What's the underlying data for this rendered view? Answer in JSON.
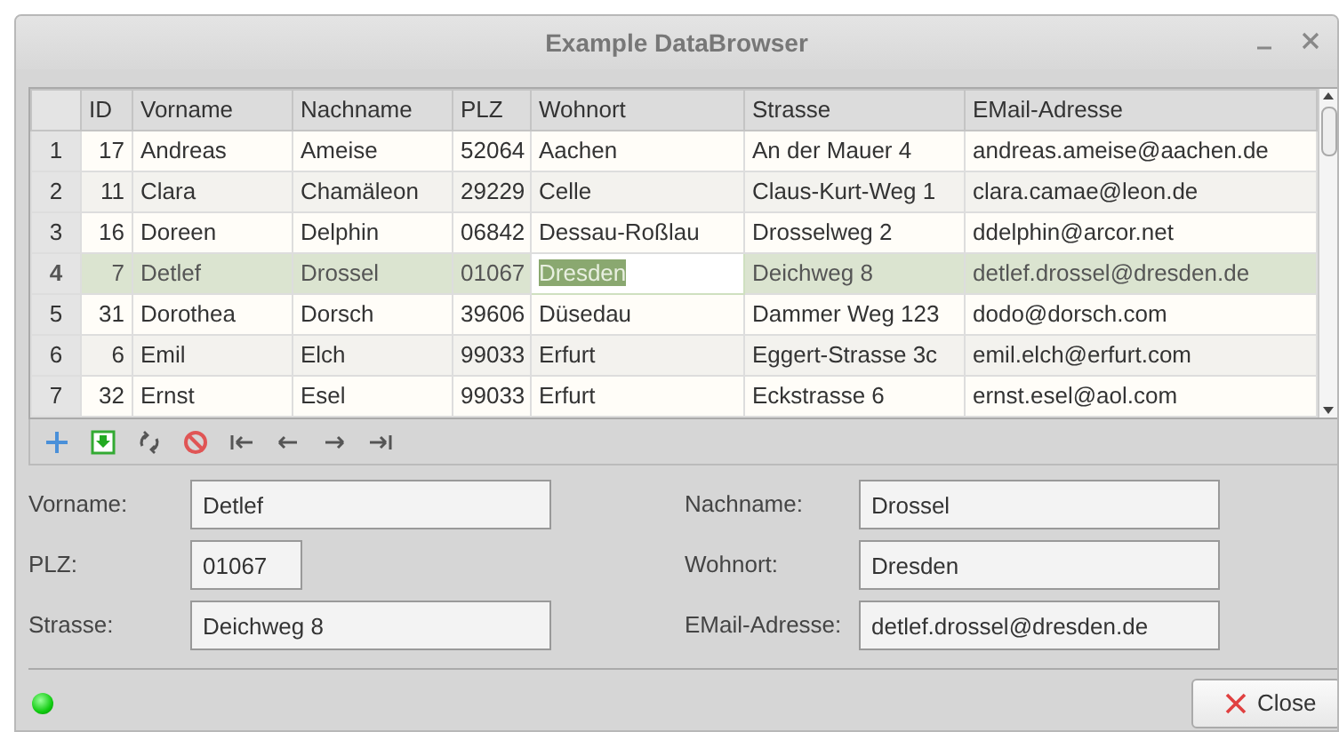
{
  "window": {
    "title": "Example DataBrowser"
  },
  "table": {
    "columns": [
      "ID",
      "Vorname",
      "Nachname",
      "PLZ",
      "Wohnort",
      "Strasse",
      "EMail-Adresse"
    ],
    "rows": [
      {
        "number": "1",
        "selected": false,
        "cells": [
          {
            "text": "17",
            "editing": false
          },
          {
            "text": "Andreas",
            "editing": false
          },
          {
            "text": "Ameise",
            "editing": false
          },
          {
            "text": "52064",
            "editing": false
          },
          {
            "text": "Aachen",
            "editing": false
          },
          {
            "text": "An der Mauer 4",
            "editing": false
          },
          {
            "text": "andreas.ameise@aachen.de",
            "editing": false
          }
        ]
      },
      {
        "number": "2",
        "selected": false,
        "cells": [
          {
            "text": "11",
            "editing": false
          },
          {
            "text": "Clara",
            "editing": false
          },
          {
            "text": "Chamäleon",
            "editing": false
          },
          {
            "text": "29229",
            "editing": false
          },
          {
            "text": "Celle",
            "editing": false
          },
          {
            "text": "Claus-Kurt-Weg 1",
            "editing": false
          },
          {
            "text": "clara.camae@leon.de",
            "editing": false
          }
        ]
      },
      {
        "number": "3",
        "selected": false,
        "cells": [
          {
            "text": "16",
            "editing": false
          },
          {
            "text": "Doreen",
            "editing": false
          },
          {
            "text": "Delphin",
            "editing": false
          },
          {
            "text": "06842",
            "editing": false
          },
          {
            "text": "Dessau-Roßlau",
            "editing": false
          },
          {
            "text": "Drosselweg 2",
            "editing": false
          },
          {
            "text": "ddelphin@arcor.net",
            "editing": false
          }
        ]
      },
      {
        "number": "4",
        "selected": true,
        "cells": [
          {
            "text": "7",
            "editing": false
          },
          {
            "text": "Detlef",
            "editing": false
          },
          {
            "text": "Drossel",
            "editing": false
          },
          {
            "text": "01067",
            "editing": false
          },
          {
            "text": "Dresden",
            "editing": true
          },
          {
            "text": "Deichweg 8",
            "editing": false
          },
          {
            "text": "detlef.drossel@dresden.de",
            "editing": false
          }
        ]
      },
      {
        "number": "5",
        "selected": false,
        "cells": [
          {
            "text": "31",
            "editing": false
          },
          {
            "text": "Dorothea",
            "editing": false
          },
          {
            "text": "Dorsch",
            "editing": false
          },
          {
            "text": "39606",
            "editing": false
          },
          {
            "text": "Düsedau",
            "editing": false
          },
          {
            "text": "Dammer Weg 123",
            "editing": false
          },
          {
            "text": "dodo@dorsch.com",
            "editing": false
          }
        ]
      },
      {
        "number": "6",
        "selected": false,
        "cells": [
          {
            "text": "6",
            "editing": false
          },
          {
            "text": "Emil",
            "editing": false
          },
          {
            "text": "Elch",
            "editing": false
          },
          {
            "text": "99033",
            "editing": false
          },
          {
            "text": "Erfurt",
            "editing": false
          },
          {
            "text": "Eggert-Strasse 3c",
            "editing": false
          },
          {
            "text": "emil.elch@erfurt.com",
            "editing": false
          }
        ]
      },
      {
        "number": "7",
        "selected": false,
        "cells": [
          {
            "text": "32",
            "editing": false
          },
          {
            "text": "Ernst",
            "editing": false
          },
          {
            "text": "Esel",
            "editing": false
          },
          {
            "text": "99033",
            "editing": false
          },
          {
            "text": "Erfurt",
            "editing": false
          },
          {
            "text": "Eckstrasse 6",
            "editing": false
          },
          {
            "text": "ernst.esel@aol.com",
            "editing": false
          }
        ]
      }
    ]
  },
  "form": {
    "left": [
      {
        "label": "Vorname:",
        "value": "Detlef",
        "kind": "wide"
      },
      {
        "label": "PLZ:",
        "value": "01067",
        "kind": "short"
      },
      {
        "label": "Strasse:",
        "value": "Deichweg 8",
        "kind": "wide"
      }
    ],
    "right": [
      {
        "label": "Nachname:",
        "value": "Drossel",
        "kind": "wide"
      },
      {
        "label": "Wohnort:",
        "value": "Dresden",
        "kind": "wide"
      },
      {
        "label": "EMail-Adresse:",
        "value": "detlef.drossel@dresden.de",
        "kind": "wide"
      }
    ]
  },
  "status": {
    "connected": true
  },
  "close_button": {
    "label": "Close"
  }
}
